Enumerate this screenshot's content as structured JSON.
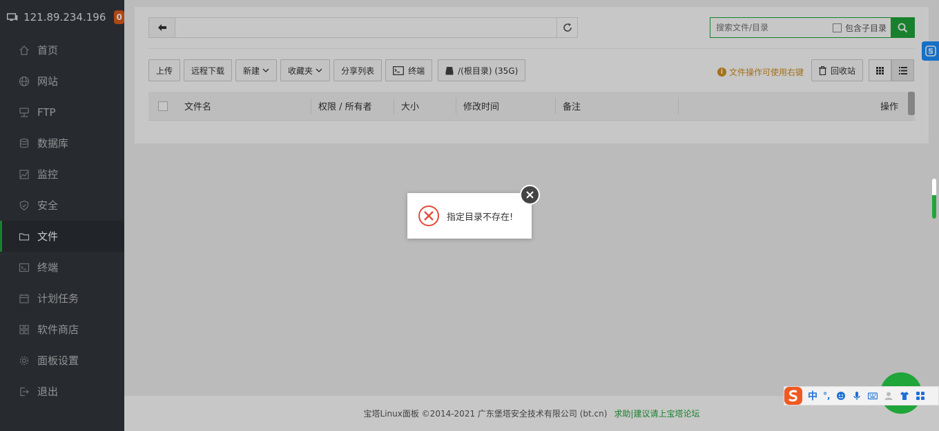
{
  "sidebar": {
    "host": "121.89.234.196",
    "badge": "0",
    "items": [
      {
        "label": "首页"
      },
      {
        "label": "网站"
      },
      {
        "label": "FTP"
      },
      {
        "label": "数据库"
      },
      {
        "label": "监控"
      },
      {
        "label": "安全"
      },
      {
        "label": "文件"
      },
      {
        "label": "终端"
      },
      {
        "label": "计划任务"
      },
      {
        "label": "软件商店"
      },
      {
        "label": "面板设置"
      },
      {
        "label": "退出"
      }
    ],
    "active_index": 6
  },
  "files": {
    "path_value": "",
    "search_placeholder": "搜索文件/目录",
    "include_subdir_label": "包含子目录",
    "toolbar": {
      "upload": "上传",
      "remote_download": "远程下载",
      "new": "新建",
      "favorites": "收藏夹",
      "share_list": "分享列表",
      "terminal": "终端",
      "disk": "/(根目录) (35G)"
    },
    "tip": "文件操作可使用右键",
    "recycle": "回收站",
    "columns": [
      "文件名",
      "权限 / 所有者",
      "大小",
      "修改时间",
      "备注",
      "操作"
    ]
  },
  "footer": {
    "copyright": "宝塔Linux面板 ©2014-2021 广东堡塔安全技术有限公司 (bt.cn)",
    "link": "求助|建议请上宝塔论坛"
  },
  "dialog": {
    "message": "指定目录不存在!"
  },
  "ime": {
    "mode": "中",
    "punct": "°,"
  },
  "colors": {
    "accent": "#20a53a",
    "sidebar_bg": "#32373d",
    "badge": "#e05a1a",
    "error": "#e04a3a"
  }
}
